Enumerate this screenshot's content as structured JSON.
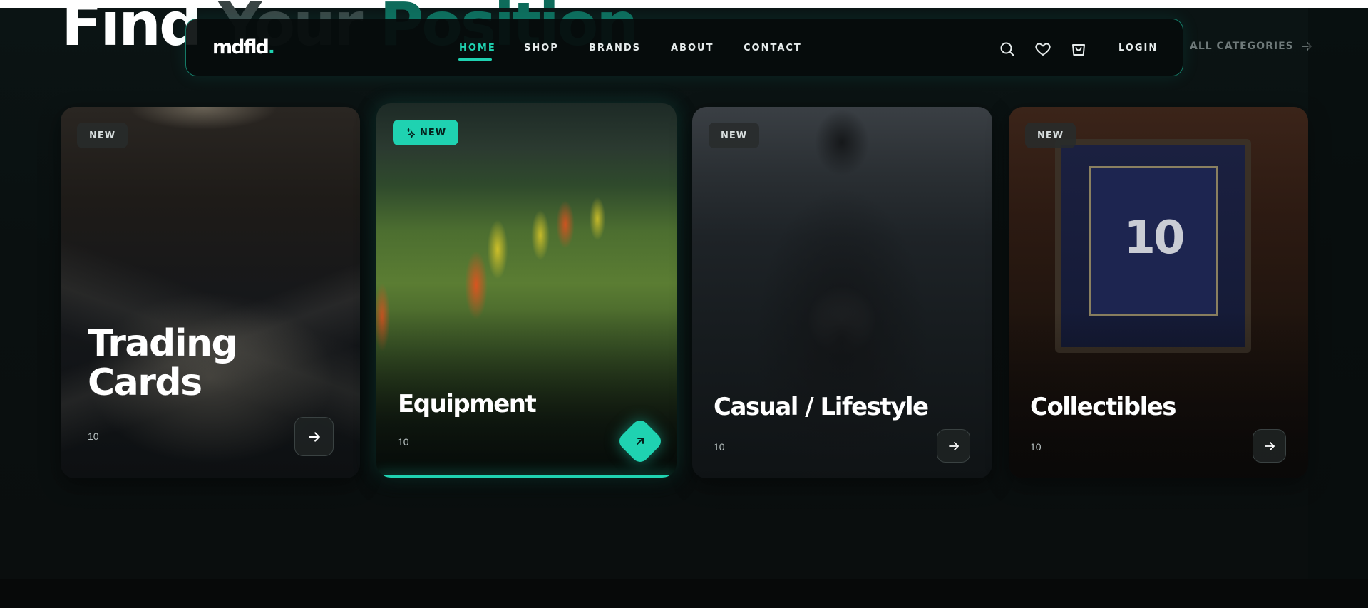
{
  "headline": {
    "word1": "Find",
    "word2": "Your",
    "word3": "Position"
  },
  "navbar": {
    "logo": "mdfld",
    "logo_dot": ".",
    "items": [
      {
        "label": "HOME",
        "active": true
      },
      {
        "label": "SHOP",
        "active": false
      },
      {
        "label": "BRANDS",
        "active": false
      },
      {
        "label": "ABOUT",
        "active": false
      },
      {
        "label": "CONTACT",
        "active": false
      }
    ],
    "icons": [
      "search-icon",
      "heart-icon",
      "shopping-bag-icon"
    ],
    "login_label": "LOGIN"
  },
  "all_categories": "ALL CATEGORIES",
  "cards": [
    {
      "badge": "NEW",
      "title_line1": "Trading",
      "title_line2": "Cards",
      "count": "10",
      "active": false
    },
    {
      "badge": "NEW",
      "title": "Equipment",
      "count": "10",
      "active": true
    },
    {
      "badge": "NEW",
      "title": "Casual / Lifestyle",
      "count": "10",
      "active": false
    },
    {
      "badge": "NEW",
      "title": "Collectibles",
      "count": "10",
      "active": false
    }
  ],
  "colors": {
    "accent": "#1fd2b1",
    "background": "#0a0f0f",
    "nav_border": "#157a66"
  }
}
